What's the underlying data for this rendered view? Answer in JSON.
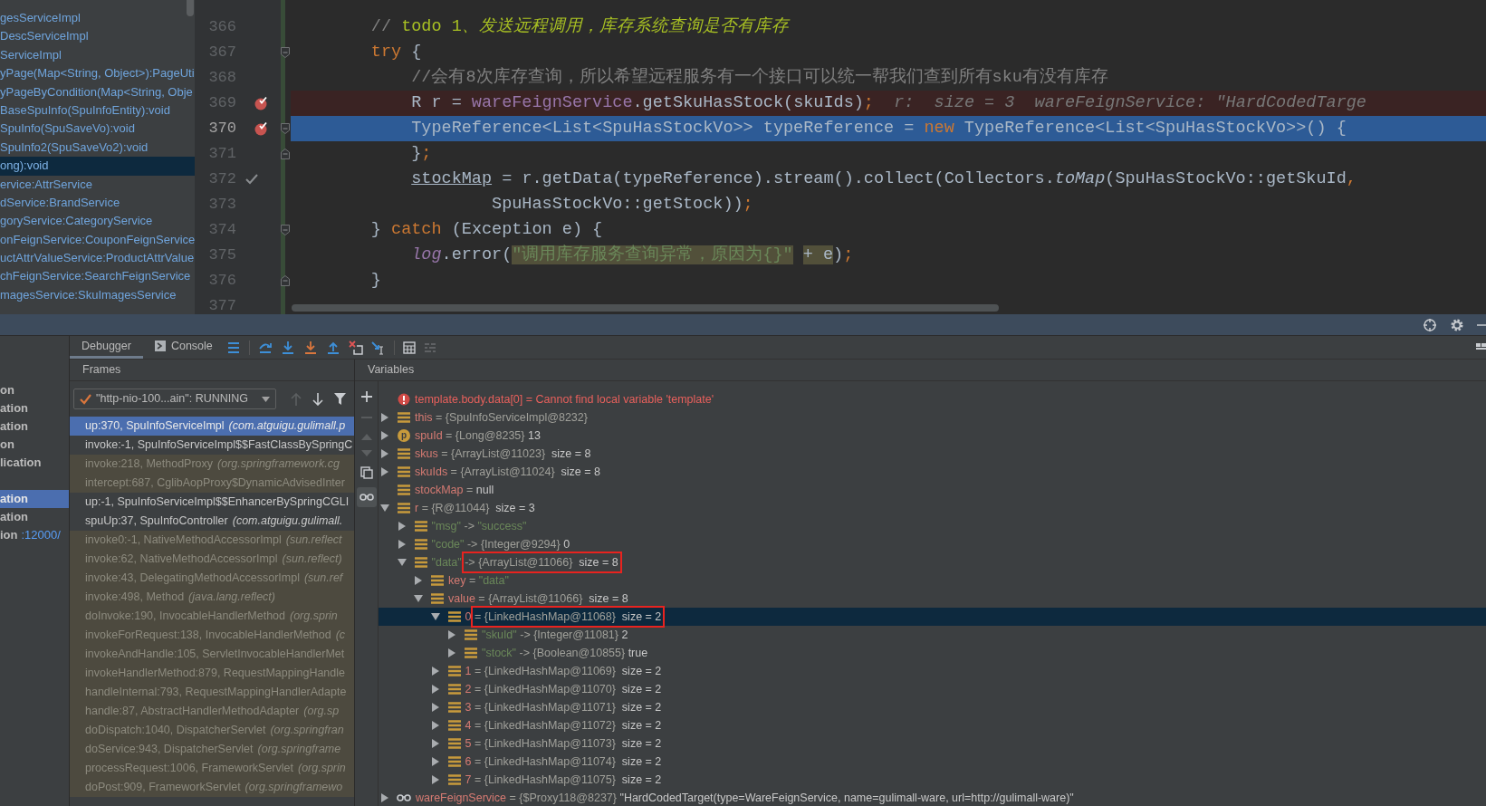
{
  "structure": {
    "items": [
      {
        "text": "gesServiceImpl",
        "selected": false
      },
      {
        "text": "DescServiceImpl",
        "selected": false
      },
      {
        "text": "ServiceImpl",
        "selected": false
      },
      {
        "text": "yPage(Map<String, Object>):PageUti",
        "selected": false
      },
      {
        "text": "yPageByCondition(Map<String, Obje",
        "selected": false
      },
      {
        "text": "BaseSpuInfo(SpuInfoEntity):void",
        "selected": false
      },
      {
        "text": "SpuInfo(SpuSaveVo):void",
        "selected": false
      },
      {
        "text": "SpuInfo2(SpuSaveVo2):void",
        "selected": false
      },
      {
        "text": "ong):void",
        "selected": true
      },
      {
        "text": "ervice:AttrService",
        "selected": false
      },
      {
        "text": "dService:BrandService",
        "selected": false
      },
      {
        "text": "goryService:CategoryService",
        "selected": false
      },
      {
        "text": "onFeignService:CouponFeignService",
        "selected": false
      },
      {
        "text": "uctAttrValueService:ProductAttrValue",
        "selected": false
      },
      {
        "text": "chFeignService:SearchFeignService",
        "selected": false
      },
      {
        "text": "magesService:SkuImagesService",
        "selected": false
      }
    ]
  },
  "editor": {
    "lines": [
      {
        "number": "366",
        "breakpoint": false,
        "current": false,
        "executed": false,
        "fold_start": false,
        "fold_end": false,
        "tokens": [
          {
            "kind": "comment",
            "text": "        // "
          },
          {
            "kind": "todo",
            "text": "todo 1"
          },
          {
            "kind": "todo_italic",
            "text": "、发送远程调用，库存系统查询是否有库存"
          }
        ]
      },
      {
        "number": "367",
        "breakpoint": false,
        "current": false,
        "executed": false,
        "fold_start": true,
        "fold_end": false,
        "tokens": [
          {
            "kind": "keyword",
            "text": "        try"
          },
          {
            "kind": "plain",
            "text": " {"
          }
        ]
      },
      {
        "number": "368",
        "breakpoint": false,
        "current": false,
        "executed": false,
        "fold_start": false,
        "fold_end": false,
        "tokens": [
          {
            "kind": "comment",
            "text": "            //会有8次库存查询，所以希望远程服务有一个接口可以统一帮我们查到所有sku有没有库存"
          }
        ]
      },
      {
        "number": "369",
        "breakpoint": true,
        "current": false,
        "executed": false,
        "fold_start": false,
        "fold_end": false,
        "tokens": [
          {
            "kind": "plain",
            "text": "            R r = "
          },
          {
            "kind": "field",
            "text": "wareFeignService"
          },
          {
            "kind": "plain",
            "text": ".getSkuHasStock(skuIds)"
          },
          {
            "kind": "keyword",
            "text": ";"
          },
          {
            "kind": "hint",
            "text": "  r:  size = 3  wareFeignService: \"HardCodedTarge"
          }
        ]
      },
      {
        "number": "370",
        "breakpoint": true,
        "current": true,
        "executed": false,
        "fold_start": true,
        "fold_end": false,
        "tokens": [
          {
            "kind": "plain",
            "text": "            TypeReference<List<SpuHasStockVo>> typeReference = "
          },
          {
            "kind": "keyword",
            "text": "new"
          },
          {
            "kind": "plain",
            "text": " TypeReference<List<SpuHasStockVo>>() {"
          }
        ]
      },
      {
        "number": "371",
        "breakpoint": false,
        "current": false,
        "executed": false,
        "fold_start": false,
        "fold_end": true,
        "tokens": [
          {
            "kind": "plain",
            "text": "            }"
          },
          {
            "kind": "keyword",
            "text": ";"
          }
        ]
      },
      {
        "number": "372",
        "breakpoint": false,
        "current": false,
        "executed": true,
        "fold_start": false,
        "fold_end": false,
        "tokens": [
          {
            "kind": "underline",
            "text": "            stockMap"
          },
          {
            "kind": "plain",
            "text": " = r.getData(typeReference).stream().collect(Collectors."
          },
          {
            "kind": "static_method",
            "text": "toMap"
          },
          {
            "kind": "plain",
            "text": "(SpuHasStockVo::getSkuId"
          },
          {
            "kind": "keyword",
            "text": ","
          }
        ]
      },
      {
        "number": "373",
        "breakpoint": false,
        "current": false,
        "executed": false,
        "fold_start": false,
        "fold_end": false,
        "tokens": [
          {
            "kind": "plain",
            "text": "                    SpuHasStockVo::getStock))"
          },
          {
            "kind": "keyword",
            "text": ";"
          }
        ]
      },
      {
        "number": "374",
        "breakpoint": false,
        "current": false,
        "executed": false,
        "fold_start": true,
        "fold_end": false,
        "tokens": [
          {
            "kind": "plain",
            "text": "        } "
          },
          {
            "kind": "keyword",
            "text": "catch"
          },
          {
            "kind": "plain",
            "text": " (Exception e) {"
          }
        ]
      },
      {
        "number": "375",
        "breakpoint": false,
        "current": false,
        "executed": false,
        "fold_start": false,
        "fold_end": false,
        "tokens": [
          {
            "kind": "static_field",
            "text": "            log"
          },
          {
            "kind": "plain",
            "text": ".error("
          },
          {
            "kind": "string_hl",
            "text": "\"调用库存服务查询异常，原因为{}\""
          },
          {
            "kind": "plain_hl",
            "text": " + e"
          },
          {
            "kind": "plain",
            "text": ")"
          },
          {
            "kind": "keyword",
            "text": ";"
          }
        ]
      },
      {
        "number": "376",
        "breakpoint": false,
        "current": false,
        "executed": false,
        "fold_start": false,
        "fold_end": true,
        "tokens": [
          {
            "kind": "plain",
            "text": "        }"
          }
        ]
      },
      {
        "number": "377"
      }
    ]
  },
  "services": {
    "groups": [
      [
        {
          "text": "on",
          "selected": false
        },
        {
          "text": "ation",
          "selected": false
        },
        {
          "text": "ation",
          "selected": false
        },
        {
          "text": "on",
          "selected": false
        },
        {
          "text": "lication",
          "selected": false
        }
      ],
      [
        {
          "text": "ation",
          "selected": true
        },
        {
          "text": "ation",
          "selected": false
        },
        {
          "text": "ion",
          "port": ":12000/",
          "selected": false
        }
      ]
    ]
  },
  "tabs": [
    {
      "label": "Debugger",
      "selected": true
    },
    {
      "label": "Console",
      "selected": false
    }
  ],
  "frames": {
    "title": "Frames",
    "thread": "\"http-nio-100...ain\": RUNNING",
    "items": [
      {
        "method": "up:370, SpuInfoServiceImpl",
        "location": "(com.atguigu.gulimall.p",
        "kind": "app",
        "selected": true
      },
      {
        "method": "invoke:-1, SpuInfoServiceImpl$$FastClassBySpringC",
        "kind": "app",
        "selected": false
      },
      {
        "method": "invoke:218, MethodProxy",
        "location": "(org.springframework.cg",
        "kind": "library",
        "selected": false
      },
      {
        "method": "intercept:687, CglibAopProxy$DynamicAdvisedInter",
        "kind": "library",
        "selected": false
      },
      {
        "method": "up:-1, SpuInfoServiceImpl$$EnhancerBySpringCGLI",
        "kind": "app",
        "selected": false
      },
      {
        "method": "spuUp:37, SpuInfoController",
        "location": "(com.atguigu.gulimall.",
        "kind": "app",
        "selected": false
      },
      {
        "method": "invoke0:-1, NativeMethodAccessorImpl",
        "location": "(sun.reflect",
        "kind": "library",
        "selected": false
      },
      {
        "method": "invoke:62, NativeMethodAccessorImpl",
        "location": "(sun.reflect)",
        "kind": "library",
        "selected": false
      },
      {
        "method": "invoke:43, DelegatingMethodAccessorImpl",
        "location": "(sun.ref",
        "kind": "library",
        "selected": false
      },
      {
        "method": "invoke:498, Method",
        "location": "(java.lang.reflect)",
        "kind": "library",
        "selected": false
      },
      {
        "method": "doInvoke:190, InvocableHandlerMethod",
        "location": "(org.sprin",
        "kind": "library",
        "selected": false
      },
      {
        "method": "invokeForRequest:138, InvocableHandlerMethod",
        "location": "(c",
        "kind": "library",
        "selected": false
      },
      {
        "method": "invokeAndHandle:105, ServletInvocableHandlerMet",
        "kind": "library",
        "selected": false
      },
      {
        "method": "invokeHandlerMethod:879, RequestMappingHandle",
        "kind": "library",
        "selected": false
      },
      {
        "method": "handleInternal:793, RequestMappingHandlerAdapte",
        "kind": "library",
        "selected": false
      },
      {
        "method": "handle:87, AbstractHandlerMethodAdapter",
        "location": "(org.sp",
        "kind": "library",
        "selected": false
      },
      {
        "method": "doDispatch:1040, DispatcherServlet",
        "location": "(org.springfran",
        "kind": "library",
        "selected": false
      },
      {
        "method": "doService:943, DispatcherServlet",
        "location": "(org.springframe",
        "kind": "library",
        "selected": false
      },
      {
        "method": "processRequest:1006, FrameworkServlet",
        "location": "(org.sprin",
        "kind": "library",
        "selected": false
      },
      {
        "method": "doPost:909, FrameworkServlet",
        "location": "(org.springframewo",
        "kind": "library",
        "selected": false
      }
    ]
  },
  "variables": {
    "title": "Variables",
    "nodes": [
      {
        "kind": "error",
        "name": "template.body.data[0]",
        "sep": " = ",
        "value": {
          "kind": "error",
          "text": "Cannot find local variable 'template'"
        },
        "expandable": false,
        "expanded": false,
        "selected": false,
        "boxed": false
      },
      {
        "kind": "field",
        "name": "this",
        "sep": " = ",
        "value": {
          "kind": "ref",
          "text": "{SpuInfoServiceImpl@8232}"
        },
        "expandable": true,
        "expanded": false,
        "selected": false,
        "boxed": false
      },
      {
        "kind": "param",
        "badge": "p",
        "name": "spuId",
        "sep": " = ",
        "value": {
          "kind": "ref",
          "text": "{Long@8235}"
        },
        "extra": " 13",
        "expandable": true,
        "expanded": false,
        "selected": false,
        "boxed": false
      },
      {
        "kind": "field",
        "name": "skus",
        "sep": " = ",
        "value": {
          "kind": "ref",
          "text": "{ArrayList@11023}"
        },
        "extra": "  size = 8",
        "expandable": true,
        "expanded": false,
        "selected": false,
        "boxed": false
      },
      {
        "kind": "field",
        "name": "skuIds",
        "sep": " = ",
        "value": {
          "kind": "ref",
          "text": "{ArrayList@11024}"
        },
        "extra": "  size = 8",
        "expandable": true,
        "expanded": false,
        "selected": false,
        "boxed": false
      },
      {
        "kind": "field",
        "name": "stockMap",
        "sep": " = ",
        "value": {
          "kind": "plain",
          "text": "null"
        },
        "expandable": false,
        "expanded": false,
        "selected": false,
        "boxed": false
      },
      {
        "kind": "field",
        "name": "r",
        "sep": " = ",
        "value": {
          "kind": "ref",
          "text": "{R@11044}"
        },
        "extra": "  size = 3",
        "expandable": true,
        "expanded": true,
        "selected": false,
        "boxed": false,
        "children": [
          {
            "kind": "entry",
            "name": "\"msg\"",
            "sep": " -> ",
            "value": {
              "kind": "string",
              "text": "\"success\""
            },
            "expandable": true,
            "expanded": false,
            "selected": false,
            "boxed": false
          },
          {
            "kind": "entry",
            "name": "\"code\"",
            "sep": " -> ",
            "value": {
              "kind": "ref",
              "text": "{Integer@9294}"
            },
            "extra": " 0",
            "expandable": true,
            "expanded": false,
            "selected": false,
            "boxed": false
          },
          {
            "kind": "entry",
            "name": "\"data\"",
            "sep": " -> ",
            "value": {
              "kind": "ref",
              "text": "{ArrayList@11066}"
            },
            "extra": "  size = 8",
            "expandable": true,
            "expanded": true,
            "selected": false,
            "boxed": true,
            "children": [
              {
                "kind": "field",
                "name": "key",
                "sep": " = ",
                "value": {
                  "kind": "string",
                  "text": "\"data\""
                },
                "expandable": true,
                "expanded": false,
                "selected": false,
                "boxed": false
              },
              {
                "kind": "field",
                "name": "value",
                "sep": " = ",
                "value": {
                  "kind": "ref",
                  "text": "{ArrayList@11066}"
                },
                "extra": "  size = 8",
                "expandable": true,
                "expanded": true,
                "selected": false,
                "boxed": false,
                "children": [
                  {
                    "kind": "index",
                    "name": "0",
                    "sep": " = ",
                    "value": {
                      "kind": "ref",
                      "text": "{LinkedHashMap@11068}"
                    },
                    "extra": "  size = 2",
                    "expandable": true,
                    "expanded": true,
                    "selected": true,
                    "boxed": true,
                    "children": [
                      {
                        "kind": "entry",
                        "name": "\"skuId\"",
                        "sep": " -> ",
                        "value": {
                          "kind": "ref",
                          "text": "{Integer@11081}"
                        },
                        "extra": " 2",
                        "expandable": true,
                        "expanded": false,
                        "selected": false,
                        "boxed": false
                      },
                      {
                        "kind": "entry",
                        "name": "\"stock\"",
                        "sep": " -> ",
                        "value": {
                          "kind": "ref",
                          "text": "{Boolean@10855}"
                        },
                        "extra": " true",
                        "expandable": true,
                        "expanded": false,
                        "selected": false,
                        "boxed": false
                      }
                    ]
                  },
                  {
                    "kind": "index",
                    "name": "1",
                    "sep": " = ",
                    "value": {
                      "kind": "ref",
                      "text": "{LinkedHashMap@11069}"
                    },
                    "extra": "  size = 2",
                    "expandable": true,
                    "expanded": false,
                    "selected": false,
                    "boxed": false
                  },
                  {
                    "kind": "index",
                    "name": "2",
                    "sep": " = ",
                    "value": {
                      "kind": "ref",
                      "text": "{LinkedHashMap@11070}"
                    },
                    "extra": "  size = 2",
                    "expandable": true,
                    "expanded": false,
                    "selected": false,
                    "boxed": false
                  },
                  {
                    "kind": "index",
                    "name": "3",
                    "sep": " = ",
                    "value": {
                      "kind": "ref",
                      "text": "{LinkedHashMap@11071}"
                    },
                    "extra": "  size = 2",
                    "expandable": true,
                    "expanded": false,
                    "selected": false,
                    "boxed": false
                  },
                  {
                    "kind": "index",
                    "name": "4",
                    "sep": " = ",
                    "value": {
                      "kind": "ref",
                      "text": "{LinkedHashMap@11072}"
                    },
                    "extra": "  size = 2",
                    "expandable": true,
                    "expanded": false,
                    "selected": false,
                    "boxed": false
                  },
                  {
                    "kind": "index",
                    "name": "5",
                    "sep": " = ",
                    "value": {
                      "kind": "ref",
                      "text": "{LinkedHashMap@11073}"
                    },
                    "extra": "  size = 2",
                    "expandable": true,
                    "expanded": false,
                    "selected": false,
                    "boxed": false
                  },
                  {
                    "kind": "index",
                    "name": "6",
                    "sep": " = ",
                    "value": {
                      "kind": "ref",
                      "text": "{LinkedHashMap@11074}"
                    },
                    "extra": "  size = 2",
                    "expandable": true,
                    "expanded": false,
                    "selected": false,
                    "boxed": false
                  },
                  {
                    "kind": "index",
                    "name": "7",
                    "sep": " = ",
                    "value": {
                      "kind": "ref",
                      "text": "{LinkedHashMap@11075}"
                    },
                    "extra": "  size = 2",
                    "expandable": true,
                    "expanded": false,
                    "selected": false,
                    "boxed": false
                  }
                ]
              }
            ]
          }
        ]
      },
      {
        "kind": "watch",
        "name": "wareFeignService",
        "sep": " = ",
        "value": {
          "kind": "ref",
          "text": "{$Proxy118@8237}"
        },
        "extra": " \"HardCodedTarget(type=WareFeignService, name=gulimall-ware, url=http://gulimall-ware)\"",
        "expandable": true,
        "expanded": false,
        "selected": false,
        "boxed": false
      }
    ]
  }
}
